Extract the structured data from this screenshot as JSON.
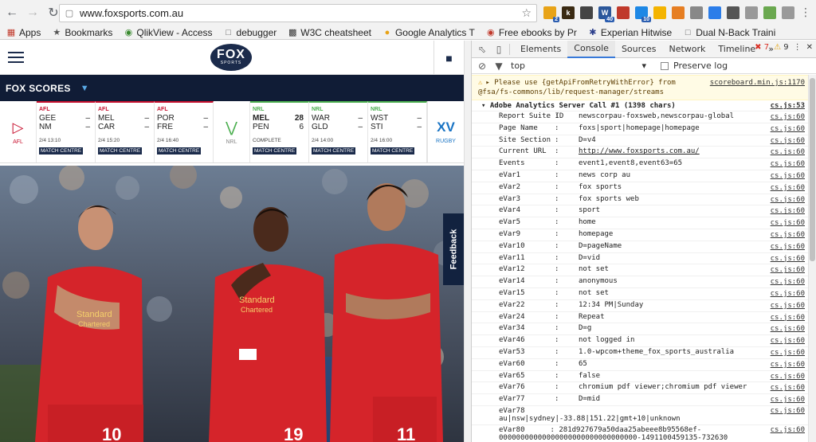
{
  "browser": {
    "url": "www.foxsports.com.au",
    "bookmarks": [
      "Apps",
      "Bookmarks",
      "QlikView - Access",
      "debugger",
      "W3C cheatsheet",
      "Google Analytics T",
      "Free ebooks by Pr",
      "Experian Hitwise",
      "Dual N-Back Traini"
    ],
    "extensions": [
      {
        "label": "",
        "badge": "2",
        "color": "#e8a317"
      },
      {
        "label": "k",
        "badge": "",
        "color": "#3a2a12"
      },
      {
        "label": "",
        "badge": "",
        "color": "#444444"
      },
      {
        "label": "W",
        "badge": "40",
        "color": "#2b579a"
      },
      {
        "label": "",
        "badge": "",
        "color": "#c0392b"
      },
      {
        "label": "",
        "badge": "10",
        "color": "#1e88e5"
      },
      {
        "label": "",
        "badge": "",
        "color": "#f4b400"
      },
      {
        "label": "",
        "badge": "",
        "color": "#e67e22"
      },
      {
        "label": "",
        "badge": "",
        "color": "#888888"
      },
      {
        "label": "",
        "badge": "",
        "color": "#2b7de9"
      },
      {
        "label": "",
        "badge": "",
        "color": "#555555"
      },
      {
        "label": "",
        "badge": "",
        "color": "#999999"
      },
      {
        "label": "",
        "badge": "",
        "color": "#6aa84f"
      },
      {
        "label": "",
        "badge": "",
        "color": "#999999"
      }
    ]
  },
  "site": {
    "logo_text": "FOX",
    "logo_sub": "SPORTS",
    "scores_title": "FOX SCORES",
    "feedback_label": "Feedback",
    "leagues": {
      "afl": "AFL",
      "nrl": "NRL",
      "rugby": "RUGBY",
      "rugby_logo": "XV"
    },
    "matches": [
      {
        "comp": "AFL",
        "home": "GEE",
        "home_score": "–",
        "away": "NM",
        "away_score": "–",
        "when": "2/4 13:10",
        "cta": "MATCH CENTRE"
      },
      {
        "comp": "AFL",
        "home": "MEL",
        "home_score": "–",
        "away": "CAR",
        "away_score": "–",
        "when": "2/4 15:20",
        "cta": "MATCH CENTRE"
      },
      {
        "comp": "AFL",
        "home": "POR",
        "home_score": "–",
        "away": "FRE",
        "away_score": "–",
        "when": "2/4 16:40",
        "cta": "MATCH CENTRE"
      },
      {
        "comp": "NRL",
        "home": "MEL",
        "home_score": "28",
        "away": "PEN",
        "away_score": "6",
        "when": "COMPLETE",
        "cta": "MATCH CENTRE"
      },
      {
        "comp": "NRL",
        "home": "WAR",
        "home_score": "–",
        "away": "GLD",
        "away_score": "–",
        "when": "2/4 14:00",
        "cta": "MATCH CENTRE"
      },
      {
        "comp": "NRL",
        "home": "WST",
        "home_score": "–",
        "away": "STI",
        "away_score": "–",
        "when": "2/4 16:00",
        "cta": "MATCH CENTRE"
      }
    ],
    "jerseys": [
      {
        "sponsor1": "Standard",
        "sponsor2": "Chartered",
        "number": "10"
      },
      {
        "sponsor1": "Standard",
        "sponsor2": "Chartered",
        "number": "19"
      },
      {
        "sponsor1": "",
        "sponsor2": "",
        "number": "11"
      }
    ]
  },
  "devtools": {
    "tabs": [
      "Elements",
      "Console",
      "Sources",
      "Network",
      "Timeline"
    ],
    "more": "»",
    "errors": "7",
    "warnings": "9",
    "context": "top",
    "preserve_log": "Preserve log",
    "warning_text_1": "Please use {getApiFromRetryWithError} from",
    "warning_text_2": "@fsa/fs-commons/lib/request-manager/streams",
    "warning_link": "scoreboard.min.js:1170",
    "group_title": "Adobe Analytics Server Call #1 (1398 chars)",
    "group_link": "cs.js:53",
    "rows": [
      {
        "key": "Report Suite ID",
        "value": "newscorpau-foxsweb,newscorpau-global",
        "src": "cs.js:60"
      },
      {
        "key": "Page Name",
        "value": "foxs|sport|homepage|homepage",
        "src": "cs.js:60"
      },
      {
        "key": "Site Section",
        "value": "D=v4",
        "src": "cs.js:60"
      },
      {
        "key": "Current URL",
        "value": "http://www.foxsports.com.au/",
        "src": "cs.js:60"
      },
      {
        "key": "Events",
        "value": "event1,event8,event63=65",
        "src": "cs.js:60"
      },
      {
        "key": "eVar1",
        "value": "news corp au",
        "src": "cs.js:60"
      },
      {
        "key": "eVar2",
        "value": "fox sports",
        "src": "cs.js:60"
      },
      {
        "key": "eVar3",
        "value": "fox sports web",
        "src": "cs.js:60"
      },
      {
        "key": "eVar4",
        "value": "sport",
        "src": "cs.js:60"
      },
      {
        "key": "eVar5",
        "value": "home",
        "src": "cs.js:60"
      },
      {
        "key": "eVar9",
        "value": "homepage",
        "src": "cs.js:60"
      },
      {
        "key": "eVar10",
        "value": "D=pageName",
        "src": "cs.js:60"
      },
      {
        "key": "eVar11",
        "value": "D=vid",
        "src": "cs.js:60"
      },
      {
        "key": "eVar12",
        "value": "not set",
        "src": "cs.js:60"
      },
      {
        "key": "eVar14",
        "value": "anonymous",
        "src": "cs.js:60"
      },
      {
        "key": "eVar15",
        "value": "not set",
        "src": "cs.js:60"
      },
      {
        "key": "eVar22",
        "value": "12:34 PM|Sunday",
        "src": "cs.js:60"
      },
      {
        "key": "eVar24",
        "value": "Repeat",
        "src": "cs.js:60"
      },
      {
        "key": "eVar34",
        "value": "D=g",
        "src": "cs.js:60"
      },
      {
        "key": "eVar46",
        "value": "not logged in",
        "src": "cs.js:60"
      },
      {
        "key": "eVar53",
        "value": "1.0-wpcom+theme_fox_sports_australia",
        "src": "cs.js:60"
      },
      {
        "key": "eVar60",
        "value": "65",
        "src": "cs.js:60"
      },
      {
        "key": "eVar65",
        "value": "false",
        "src": "cs.js:60"
      },
      {
        "key": "eVar76",
        "value": "chromium pdf viewer;chromium pdf viewer",
        "src": "cs.js:60"
      },
      {
        "key": "eVar77",
        "value": "D=mid",
        "src": "cs.js:60"
      }
    ],
    "wrap_rows": [
      {
        "key": "eVar78",
        "value": "au|nsw|sydney|-33.88|151.22|gmt+10|unknown",
        "src": "cs.js:60"
      },
      {
        "key": "eVar80",
        "value": "281d927679a50daa25abeee8b95568ef-",
        "value2": "00000000000000000000000000000000-1491100459135-732630",
        "src": "cs.js:60"
      }
    ]
  }
}
